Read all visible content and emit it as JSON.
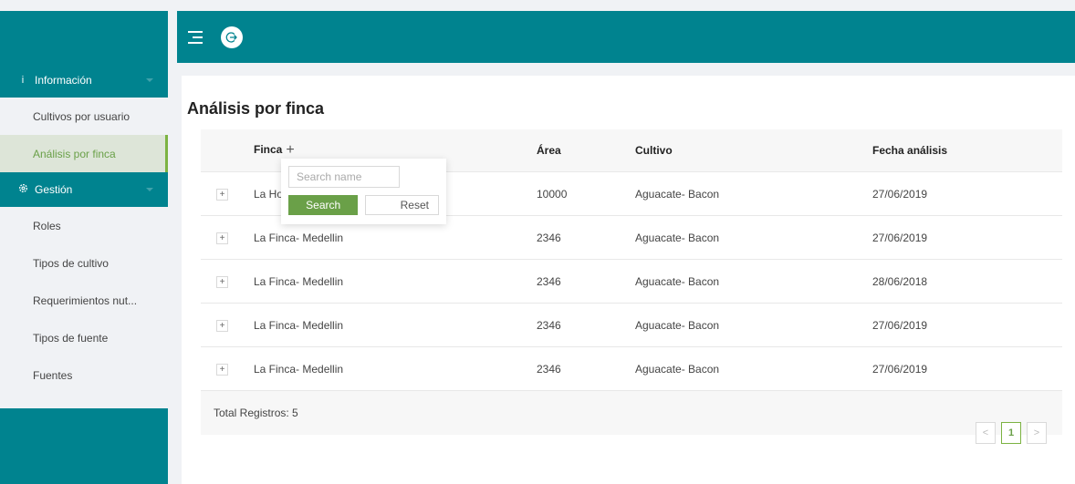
{
  "sidebar": {
    "groups": [
      {
        "icon": "info-icon",
        "label": "Información"
      },
      {
        "icon": "gear-icon",
        "label": "Gestión"
      }
    ],
    "items_info": [
      {
        "label": "Cultivos por usuario",
        "active": false
      },
      {
        "label": "Análisis por finca",
        "active": true
      }
    ],
    "items_gestion": [
      {
        "label": "Roles"
      },
      {
        "label": "Tipos de cultivo"
      },
      {
        "label": "Requerimientos nut..."
      },
      {
        "label": "Tipos de fuente"
      },
      {
        "label": "Fuentes"
      }
    ]
  },
  "header": {
    "menu_icon": "menu-fold-icon",
    "logout_icon": "logout-icon"
  },
  "page": {
    "title": "Análisis por finca"
  },
  "table": {
    "columns": [
      "Finca",
      "Área",
      "Cultivo",
      "Fecha análisis"
    ],
    "rows": [
      {
        "finca": "La Ho",
        "area": "10000",
        "cultivo": "Aguacate- Bacon",
        "fecha": "27/06/2019"
      },
      {
        "finca": "La Finca- Medellin",
        "area": "2346",
        "cultivo": "Aguacate- Bacon",
        "fecha": "27/06/2019"
      },
      {
        "finca": "La Finca- Medellin",
        "area": "2346",
        "cultivo": "Aguacate- Bacon",
        "fecha": "28/06/2018"
      },
      {
        "finca": "La Finca- Medellin",
        "area": "2346",
        "cultivo": "Aguacate- Bacon",
        "fecha": "27/06/2019"
      },
      {
        "finca": "La Finca- Medellin",
        "area": "2346",
        "cultivo": "Aguacate- Bacon",
        "fecha": "27/06/2019"
      }
    ],
    "expand_symbol": "+",
    "filter_symbol": "+",
    "footer": "Total Registros: 5"
  },
  "filter": {
    "placeholder": "Search name",
    "value": "",
    "search_label": "Search",
    "reset_label": "Reset"
  },
  "pagination": {
    "prev": "<",
    "current": "1",
    "next": ">"
  },
  "colors": {
    "primary": "#00838f",
    "accent": "#6aa048",
    "active_bg": "#dde5d8"
  }
}
